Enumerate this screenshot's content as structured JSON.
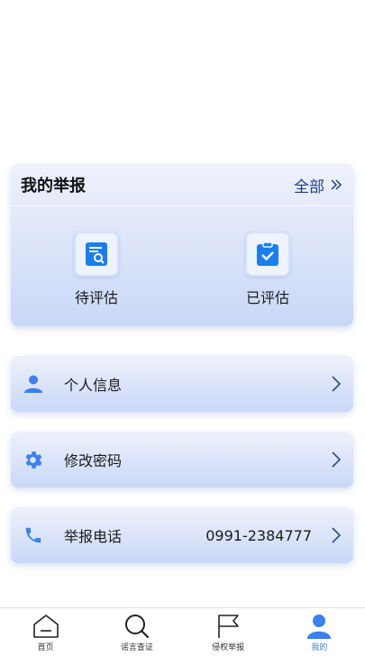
{
  "report": {
    "title": "我的举报",
    "all_label": "全部",
    "items": [
      {
        "label": "待评估",
        "icon": "pending-evaluation-icon"
      },
      {
        "label": "已评估",
        "icon": "evaluated-icon"
      }
    ]
  },
  "menu": [
    {
      "label": "个人信息",
      "icon": "user-icon",
      "value": ""
    },
    {
      "label": "修改密码",
      "icon": "gear-icon",
      "value": ""
    },
    {
      "label": "举报电话",
      "icon": "phone-icon",
      "value": "0991-2384777"
    }
  ],
  "tabs": [
    {
      "label": "首页",
      "icon": "home-icon"
    },
    {
      "label": "谣言查证",
      "icon": "search-icon"
    },
    {
      "label": "侵权举报",
      "icon": "flag-icon"
    },
    {
      "label": "我的",
      "icon": "profile-icon"
    }
  ],
  "colors": {
    "accent": "#3b7ff0",
    "link": "#1e3e86",
    "card_top": "#eef1fb",
    "card_bottom": "#c9d8f7"
  }
}
